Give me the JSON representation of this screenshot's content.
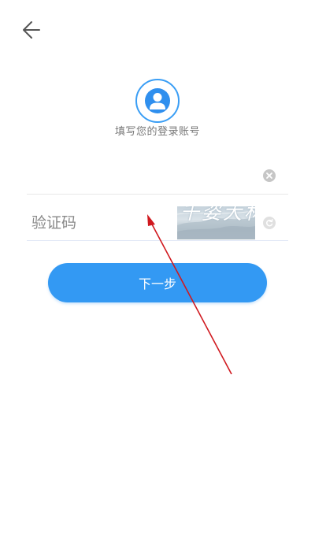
{
  "header": {
    "back_icon": "arrow-left-icon"
  },
  "avatar": {
    "icon": "user-icon",
    "accent_color": "#3a9ef5"
  },
  "caption": "填写您的登录账号",
  "account": {
    "value": "",
    "placeholder": "",
    "clear_icon": "clear-circle-x-icon"
  },
  "captcha": {
    "placeholder": "验证码",
    "image_text": "千姿大林",
    "refresh_icon": "refresh-icon"
  },
  "next_button": {
    "label": "下一步",
    "color": "#3399f3"
  },
  "annotation": {
    "type": "red-arrow",
    "color": "#d0191f"
  }
}
